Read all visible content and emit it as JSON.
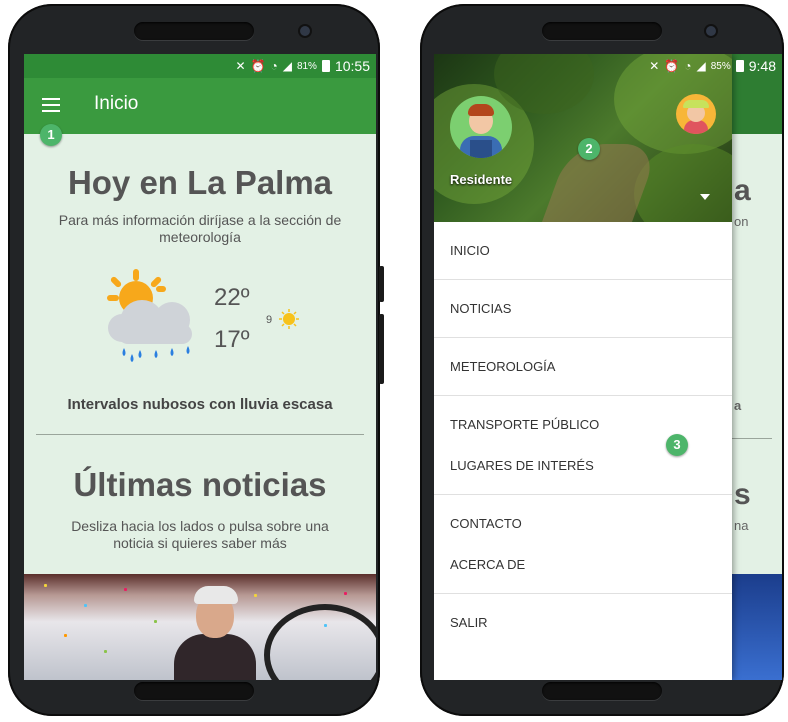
{
  "left_screen": {
    "status": {
      "battery": "81%",
      "time": "10:55"
    },
    "title": "Inicio",
    "badge": "1",
    "heading": "Hoy en La Palma",
    "subtitle": "Para más información diríjase a la sección de meteorología",
    "temp_high": "22º",
    "temp_low": "17º",
    "uv_index": "9",
    "weather_desc": "Intervalos nubosos con lluvia escasa",
    "news_heading": "Últimas noticias",
    "news_subtitle": "Desliza hacia los lados o pulsa sobre una noticia si quieres saber más"
  },
  "right_screen": {
    "status": {
      "battery": "85%",
      "time": "9:48"
    },
    "user_role": "Residente",
    "badge_header": "2",
    "badge_menu": "3",
    "bg_fragments": {
      "a": "a",
      "on": "on",
      "a2": "a",
      "s": "s",
      "na": "na"
    },
    "menu": [
      {
        "label": "INICIO"
      },
      {
        "label": "NOTICIAS"
      },
      {
        "label": "METEOROLOGÍA"
      },
      {
        "label": "TRANSPORTE PÚBLICO"
      },
      {
        "label": "LUGARES DE INTERÉS"
      },
      {
        "label": "CONTACTO"
      },
      {
        "label": "ACERCA DE"
      },
      {
        "label": "SALIR"
      }
    ]
  },
  "colors": {
    "status_bar": "#2e8b36",
    "app_bar": "#3a9a3f",
    "badge": "#4db56a",
    "screen_bg": "#e3f1e5"
  },
  "icons": [
    "menu-icon",
    "mute-icon",
    "alarm-icon",
    "wifi-icon",
    "signal-icon",
    "battery-icon",
    "sun-cloud-rain-icon",
    "sun-icon",
    "dropdown-caret-icon"
  ]
}
